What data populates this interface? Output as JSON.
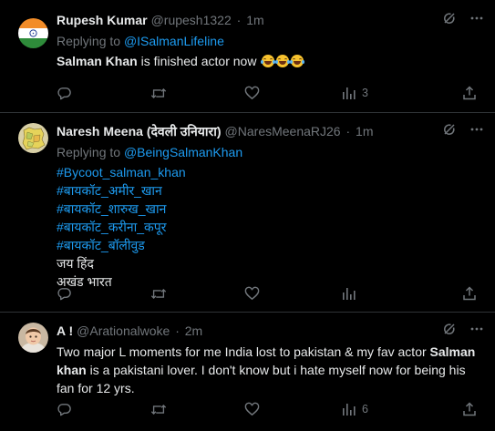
{
  "colors": {
    "background": "#000000",
    "text": "#e7e9ea",
    "secondary": "#71767b",
    "link": "#1d9bf0",
    "divider": "#2f3336"
  },
  "tweets": [
    {
      "display_name": "Rupesh Kumar",
      "handle": "@rupesh1322",
      "separator": "·",
      "time": "1m",
      "replying_prefix": "Replying to",
      "replying_to": "@ISalmanLifeline",
      "text_bold": "Salman Khan",
      "text_rest": " is finished actor now",
      "emojis": [
        "face-with-tears-of-joy",
        "face-with-tears-of-joy",
        "face-with-tears-of-joy"
      ],
      "reply_count": "",
      "repost_count": "",
      "like_count": "",
      "views_count": "3",
      "avatar": "india-flag-avatar"
    },
    {
      "display_name": "Naresh Meena (देवली उनियारा)",
      "handle": "@NaresMeenaRJ26",
      "separator": "·",
      "time": "1m",
      "replying_prefix": "Replying to",
      "replying_to": "@BeingSalmanKhan",
      "hashtags": [
        "#Bycoot_salman_khan",
        "#बायकॉट_अमीर_खान",
        "#बायकॉट_शारुख_खान",
        "#बायकॉट_करीना_कपूर",
        "#बायकॉट_बॉलीवुड"
      ],
      "lines": [
        "जय हिंद",
        "अखंड भारत"
      ],
      "reply_count": "",
      "repost_count": "",
      "like_count": "",
      "views_count": "",
      "avatar": "map-avatar"
    },
    {
      "display_name": "A !",
      "handle": "@Arationalwoke",
      "separator": "·",
      "time": "2m",
      "text_part1": "Two major L moments for me India lost to pakistan & my fav actor ",
      "text_bold": "Salman khan",
      "text_part2": " is a pakistani lover. I don't know but i hate myself now for being his fan for 12 yrs.",
      "reply_count": "",
      "repost_count": "",
      "like_count": "",
      "views_count": "6",
      "avatar": "child-photo-avatar"
    }
  ],
  "icons": {
    "grok": "grok-icon",
    "more": "more-icon",
    "reply": "reply-icon",
    "repost": "repost-icon",
    "like": "like-icon",
    "views": "views-icon",
    "share": "share-icon"
  }
}
